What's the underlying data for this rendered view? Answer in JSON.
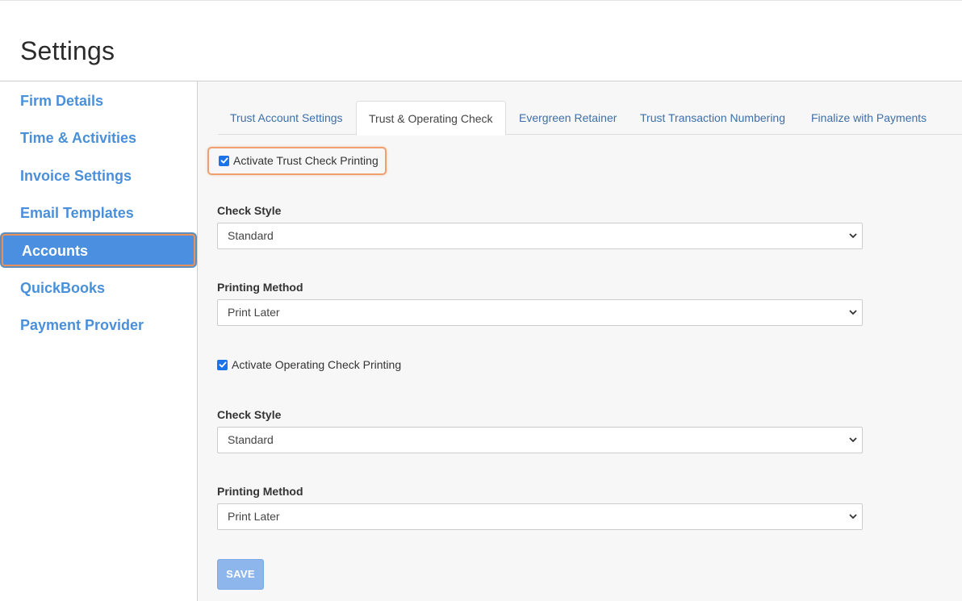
{
  "header": {
    "title": "Settings"
  },
  "sidebar": {
    "items": [
      {
        "label": "Firm Details"
      },
      {
        "label": "Time & Activities"
      },
      {
        "label": "Invoice Settings"
      },
      {
        "label": "Email Templates"
      },
      {
        "label": "Accounts",
        "active": true
      },
      {
        "label": "QuickBooks"
      },
      {
        "label": "Payment Provider"
      }
    ]
  },
  "tabs": [
    {
      "label": "Trust Account Settings"
    },
    {
      "label": "Trust & Operating Check",
      "active": true
    },
    {
      "label": "Evergreen Retainer"
    },
    {
      "label": "Trust Transaction Numbering"
    },
    {
      "label": "Finalize with Payments"
    }
  ],
  "trust": {
    "activate_label": "Activate Trust Check Printing",
    "activate_checked": true,
    "check_style_label": "Check Style",
    "check_style_value": "Standard",
    "printing_method_label": "Printing Method",
    "printing_method_value": "Print Later"
  },
  "operating": {
    "activate_label": "Activate Operating Check Printing",
    "activate_checked": true,
    "check_style_label": "Check Style",
    "check_style_value": "Standard",
    "printing_method_label": "Printing Method",
    "printing_method_value": "Print Later"
  },
  "actions": {
    "save_label": "SAVE"
  },
  "colors": {
    "link": "#4a90d9",
    "active_bg": "#4a8fe0",
    "highlight_border": "#e8915a",
    "save_bg": "#8db7ec"
  }
}
